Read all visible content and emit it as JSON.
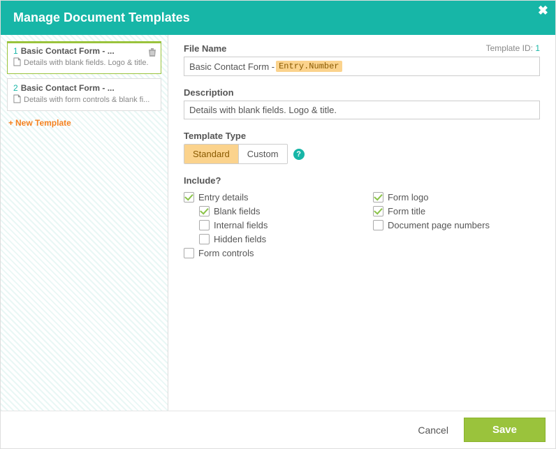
{
  "header": {
    "title": "Manage Document Templates"
  },
  "sidebar": {
    "templates": [
      {
        "num": "1",
        "title": "Basic Contact Form - ...",
        "desc": "Details with blank fields. Logo & title.",
        "active": true
      },
      {
        "num": "2",
        "title": "Basic Contact Form - ...",
        "desc": "Details with form controls & blank fi...",
        "active": false
      }
    ],
    "new_label": "New Template"
  },
  "main": {
    "template_id_label": "Template ID:",
    "template_id_value": "1",
    "filename_label": "File Name",
    "filename_prefix": "Basic Contact Form - ",
    "filename_token": "Entry.Number",
    "description_label": "Description",
    "description_value": "Details with blank fields. Logo & title.",
    "type_label": "Template Type",
    "type_options": {
      "standard": "Standard",
      "custom": "Custom"
    },
    "include_label": "Include?",
    "include": {
      "entry_details": "Entry details",
      "blank_fields": "Blank fields",
      "internal_fields": "Internal fields",
      "hidden_fields": "Hidden fields",
      "form_controls": "Form controls",
      "form_logo": "Form logo",
      "form_title": "Form title",
      "doc_page_numbers": "Document page numbers"
    }
  },
  "footer": {
    "cancel": "Cancel",
    "save": "Save"
  }
}
